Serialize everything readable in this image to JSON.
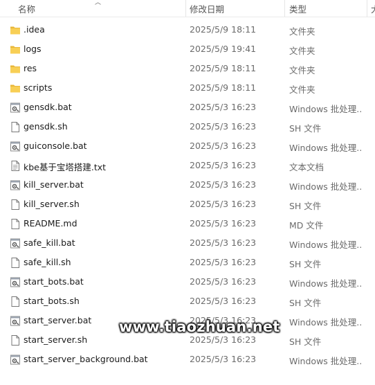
{
  "header": {
    "name": "名称",
    "date_modified": "修改日期",
    "type": "类型",
    "overflow": "大"
  },
  "files": [
    {
      "name": ".idea",
      "date": "2025/5/9 18:11",
      "type": "文件夹",
      "icon": "folder"
    },
    {
      "name": "logs",
      "date": "2025/5/9 19:41",
      "type": "文件夹",
      "icon": "folder"
    },
    {
      "name": "res",
      "date": "2025/5/9 18:11",
      "type": "文件夹",
      "icon": "folder"
    },
    {
      "name": "scripts",
      "date": "2025/5/9 18:11",
      "type": "文件夹",
      "icon": "folder"
    },
    {
      "name": "gensdk.bat",
      "date": "2025/5/3 16:23",
      "type": "Windows 批处理...",
      "icon": "bat"
    },
    {
      "name": "gensdk.sh",
      "date": "2025/5/3 16:23",
      "type": "SH 文件",
      "icon": "file"
    },
    {
      "name": "guiconsole.bat",
      "date": "2025/5/3 16:23",
      "type": "Windows 批处理...",
      "icon": "bat"
    },
    {
      "name": "kbe基于宝塔搭建.txt",
      "date": "2025/5/3 16:23",
      "type": "文本文档",
      "icon": "txt"
    },
    {
      "name": "kill_server.bat",
      "date": "2025/5/3 16:23",
      "type": "Windows 批处理...",
      "icon": "bat"
    },
    {
      "name": "kill_server.sh",
      "date": "2025/5/3 16:23",
      "type": "SH 文件",
      "icon": "file"
    },
    {
      "name": "README.md",
      "date": "2025/5/3 16:23",
      "type": "MD 文件",
      "icon": "file"
    },
    {
      "name": "safe_kill.bat",
      "date": "2025/5/3 16:23",
      "type": "Windows 批处理...",
      "icon": "bat"
    },
    {
      "name": "safe_kill.sh",
      "date": "2025/5/3 16:23",
      "type": "SH 文件",
      "icon": "file"
    },
    {
      "name": "start_bots.bat",
      "date": "2025/5/3 16:23",
      "type": "Windows 批处理...",
      "icon": "bat"
    },
    {
      "name": "start_bots.sh",
      "date": "2025/5/3 16:23",
      "type": "SH 文件",
      "icon": "file"
    },
    {
      "name": "start_server.bat",
      "date": "2025/5/3 16:23",
      "type": "Windows 批处理...",
      "icon": "bat"
    },
    {
      "name": "start_server.sh",
      "date": "2025/5/3 16:23",
      "type": "SH 文件",
      "icon": "file"
    },
    {
      "name": "start_server_background.bat",
      "date": "2025/5/3 16:23",
      "type": "Windows 批处理...",
      "icon": "bat"
    }
  ],
  "watermark": "www.tiaozhuan.net"
}
